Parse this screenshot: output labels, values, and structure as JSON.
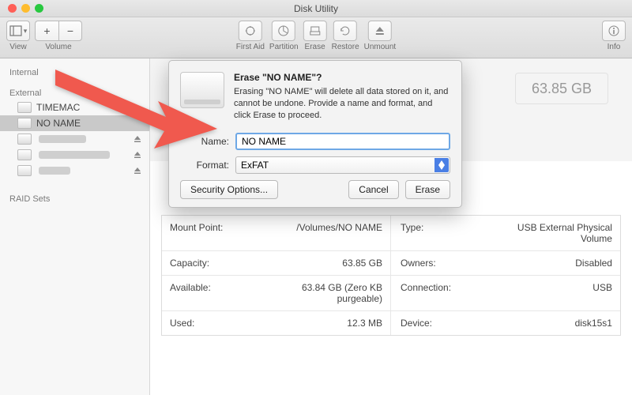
{
  "window": {
    "title": "Disk Utility"
  },
  "toolbar": {
    "view_label": "View",
    "volume_label": "Volume",
    "first_aid": "First Aid",
    "partition": "Partition",
    "erase": "Erase",
    "restore": "Restore",
    "unmount": "Unmount",
    "info": "Info"
  },
  "sidebar": {
    "internal_header": "Internal",
    "external_header": "External",
    "raid_header": "RAID Sets",
    "items": [
      {
        "label": "TIMEMAC"
      },
      {
        "label": "NO NAME"
      }
    ]
  },
  "capacity": {
    "value": "63.85 GB"
  },
  "dialog": {
    "title": "Erase \"NO NAME\"?",
    "body": "Erasing \"NO NAME\" will delete all data stored on it, and cannot be undone. Provide a name and format, and click Erase to proceed.",
    "name_label": "Name:",
    "name_value": "NO NAME",
    "format_label": "Format:",
    "format_value": "ExFAT",
    "security_options": "Security Options...",
    "cancel": "Cancel",
    "erase": "Erase"
  },
  "details": {
    "rows": [
      {
        "k": "Mount Point:",
        "v": "/Volumes/NO NAME",
        "k2": "Type:",
        "v2": "USB External Physical Volume"
      },
      {
        "k": "Capacity:",
        "v": "63.85 GB",
        "k2": "Owners:",
        "v2": "Disabled"
      },
      {
        "k": "Available:",
        "v": "63.84 GB (Zero KB purgeable)",
        "k2": "Connection:",
        "v2": "USB"
      },
      {
        "k": "Used:",
        "v": "12.3 MB",
        "k2": "Device:",
        "v2": "disk15s1"
      }
    ]
  }
}
